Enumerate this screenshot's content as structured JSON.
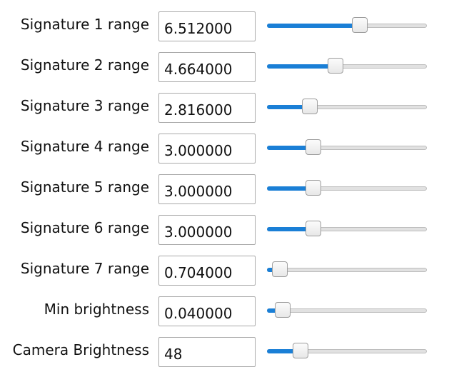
{
  "accent_color": "#1a7fd6",
  "rows": [
    {
      "label": "Signature 1 range",
      "value": "6.512000",
      "slider_fraction": 0.58
    },
    {
      "label": "Signature 2 range",
      "value": "4.664000",
      "slider_fraction": 0.43
    },
    {
      "label": "Signature 3 range",
      "value": "2.816000",
      "slider_fraction": 0.27
    },
    {
      "label": "Signature 4 range",
      "value": "3.000000",
      "slider_fraction": 0.29
    },
    {
      "label": "Signature 5 range",
      "value": "3.000000",
      "slider_fraction": 0.29
    },
    {
      "label": "Signature 6 range",
      "value": "3.000000",
      "slider_fraction": 0.29
    },
    {
      "label": "Signature 7 range",
      "value": "0.704000",
      "slider_fraction": 0.08
    },
    {
      "label": "Min brightness",
      "value": "0.040000",
      "slider_fraction": 0.1
    },
    {
      "label": "Camera Brightness",
      "value": "48",
      "slider_fraction": 0.21
    }
  ]
}
